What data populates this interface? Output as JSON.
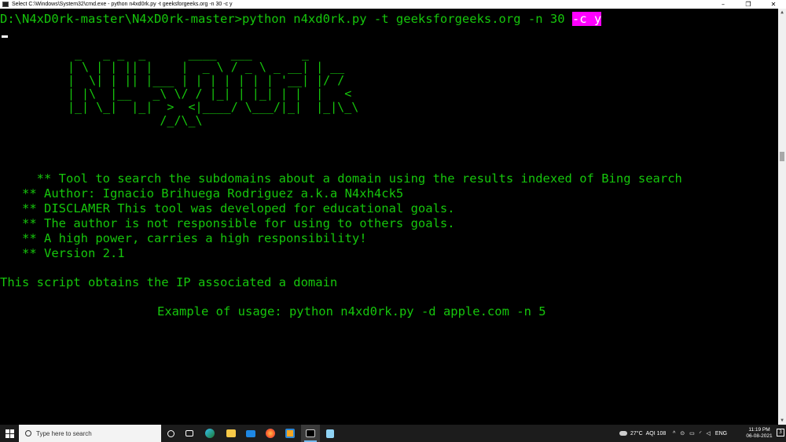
{
  "window": {
    "title": "Select C:\\Windows\\System32\\cmd.exe - python  n4xd0rk.py -t geeksforgeeks.org -n 30 -c y",
    "controls": {
      "minimize": "–",
      "restore": "❐",
      "close": "✕"
    }
  },
  "console": {
    "prompt": "D:\\N4xD0rk-master\\N4xD0rk-master>python n4xd0rk.py -t geeksforgeeks.org -n 30 ",
    "prompt_highlight": "-c y",
    "banner": " _   _ _  _      ____  ___       _\n| \\ | | || |    |  _ \\ / _ \\ _ __| | __\n|  \\| | || |___ | | | | | | | '__| |/ /\n| |\\  |__   _\\ \\/ / |_| | |_| | |  |   <\n|_| \\_|  |_|  >  <|____/ \\___/|_|  |_|\\_\\\n             /_/\\_\\",
    "info_lines": [
      "     ** Tool to search the subdomains about a domain using the results indexed of Bing search",
      "   ** Author: Ignacio Brihuega Rodriguez a.k.a N4xh4ck5",
      "   ** DISCLAMER This tool was developed for educational goals.",
      "   ** The author is not responsible for using to others goals.",
      "   ** A high power, carries a high responsibility!",
      "   ** Version 2.1"
    ],
    "script_desc": "This script obtains the IP associated a domain",
    "example": "Example of usage: python n4xd0rk.py -d apple.com -n 5"
  },
  "colors": {
    "console_bg": "#000000",
    "console_text": "#16c60c",
    "highlight_bg": "#ff00ff",
    "taskbar_bg": "#1c1c1c"
  },
  "taskbar": {
    "search_placeholder": "Type here to search",
    "apps": [
      "task-view",
      "edge",
      "file-explorer",
      "mail",
      "firefox",
      "store",
      "cmd",
      "notepad"
    ],
    "weather": "27°C",
    "aqi": "AQI 108",
    "language": "ENG",
    "time": "11:19 PM",
    "date": "06-08-2021",
    "notifications": "3"
  }
}
